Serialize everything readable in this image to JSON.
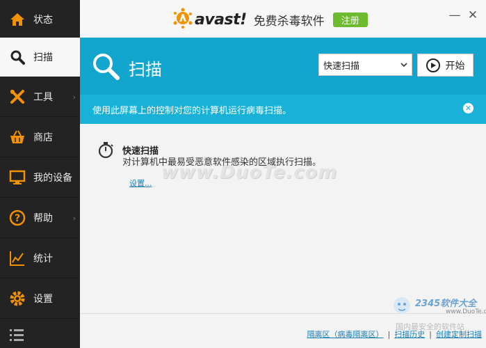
{
  "sidebar": {
    "items": [
      {
        "label": "状态",
        "icon": "home-icon"
      },
      {
        "label": "扫描",
        "icon": "search-icon"
      },
      {
        "label": "工具",
        "icon": "tools-icon"
      },
      {
        "label": "商店",
        "icon": "basket-icon"
      },
      {
        "label": "我的设备",
        "icon": "monitor-icon"
      },
      {
        "label": "帮助",
        "icon": "help-icon"
      },
      {
        "label": "统计",
        "icon": "stats-icon"
      },
      {
        "label": "设置",
        "icon": "gear-icon"
      }
    ],
    "menu_icon": "list-menu-icon"
  },
  "titlebar": {
    "logo_text": "avast!",
    "product_name": "免费杀毒软件",
    "register_label": "注册",
    "minimize_symbol": "—",
    "close_symbol": "✕"
  },
  "header": {
    "title": "扫描",
    "scan_select_value": "快速扫描",
    "start_label": "开始"
  },
  "infobar": {
    "text": "使用此屏幕上的控制对您的计算机运行病毒扫描。",
    "close_symbol": "✕"
  },
  "scan": {
    "title": "快速扫描",
    "description": "对计算机中最易受恶意软件感染的区域执行扫描。",
    "settings_link": "设置..."
  },
  "watermark": "www.DuoTe.com",
  "footer": {
    "links": [
      "隔离区（病毒隔离区）",
      "扫描历史",
      "创建定制扫描"
    ],
    "separator": "|"
  },
  "corner_watermark": {
    "brand": "2345软件大全",
    "url": "www.DuoTe.com",
    "bottom": "国内最安全的软件站"
  },
  "colors": {
    "accent": "#12a6cf",
    "infobar": "#1ab1d8",
    "sidebar": "#232323",
    "icon_orange": "#f39200",
    "register_green": "#6dbb2e"
  }
}
